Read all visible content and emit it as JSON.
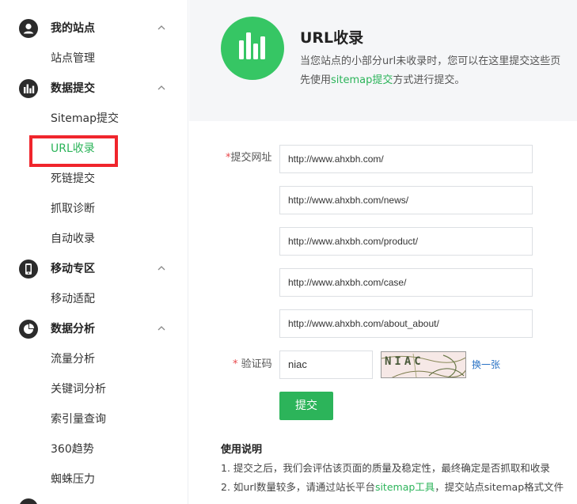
{
  "sidebar": {
    "groups": [
      {
        "title": "我的站点",
        "icon": "user-icon",
        "items": [
          "站点管理"
        ]
      },
      {
        "title": "数据提交",
        "icon": "bar-chart-icon",
        "items": [
          "Sitemap提交",
          "URL收录",
          "死链提交",
          "抓取诊断",
          "自动收录"
        ]
      },
      {
        "title": "移动专区",
        "icon": "mobile-icon",
        "items": [
          "移动适配"
        ]
      },
      {
        "title": "数据分析",
        "icon": "pie-chart-icon",
        "items": [
          "流量分析",
          "关键词分析",
          "索引量查询",
          "360趋势",
          "蜘蛛压力"
        ]
      }
    ],
    "active_item": "URL收录"
  },
  "banner": {
    "title": "URL收录",
    "desc_line1": "当您站点的小部分url未收录时，您可以在这里提交这些页",
    "desc_line2_prefix": "先使用",
    "desc_line2_link": "sitemap提交",
    "desc_line2_suffix": "方式进行提交。"
  },
  "form": {
    "url_label": "提交网址",
    "urls": [
      "http://www.ahxbh.com/",
      "http://www.ahxbh.com/news/",
      "http://www.ahxbh.com/product/",
      "http://www.ahxbh.com/case/",
      "http://www.ahxbh.com/about_about/"
    ],
    "captcha_label": "验证码",
    "captcha_value": "niac",
    "captcha_image_text": "NIAC",
    "refresh_label": "换一张",
    "submit_label": "提交"
  },
  "usage": {
    "title": "使用说明",
    "line1": "1. 提交之后，我们会评估该页面的质量及稳定性，最终确定是否抓取和收录",
    "line2_prefix": "2. 如url数量较多，请通过站长平台",
    "line2_link": "sitemap工具",
    "line2_suffix": "，提交站点sitemap格式文件"
  },
  "colors": {
    "accent": "#2cb45a",
    "highlight_box": "#f0252c",
    "link_blue": "#2a73c5"
  }
}
